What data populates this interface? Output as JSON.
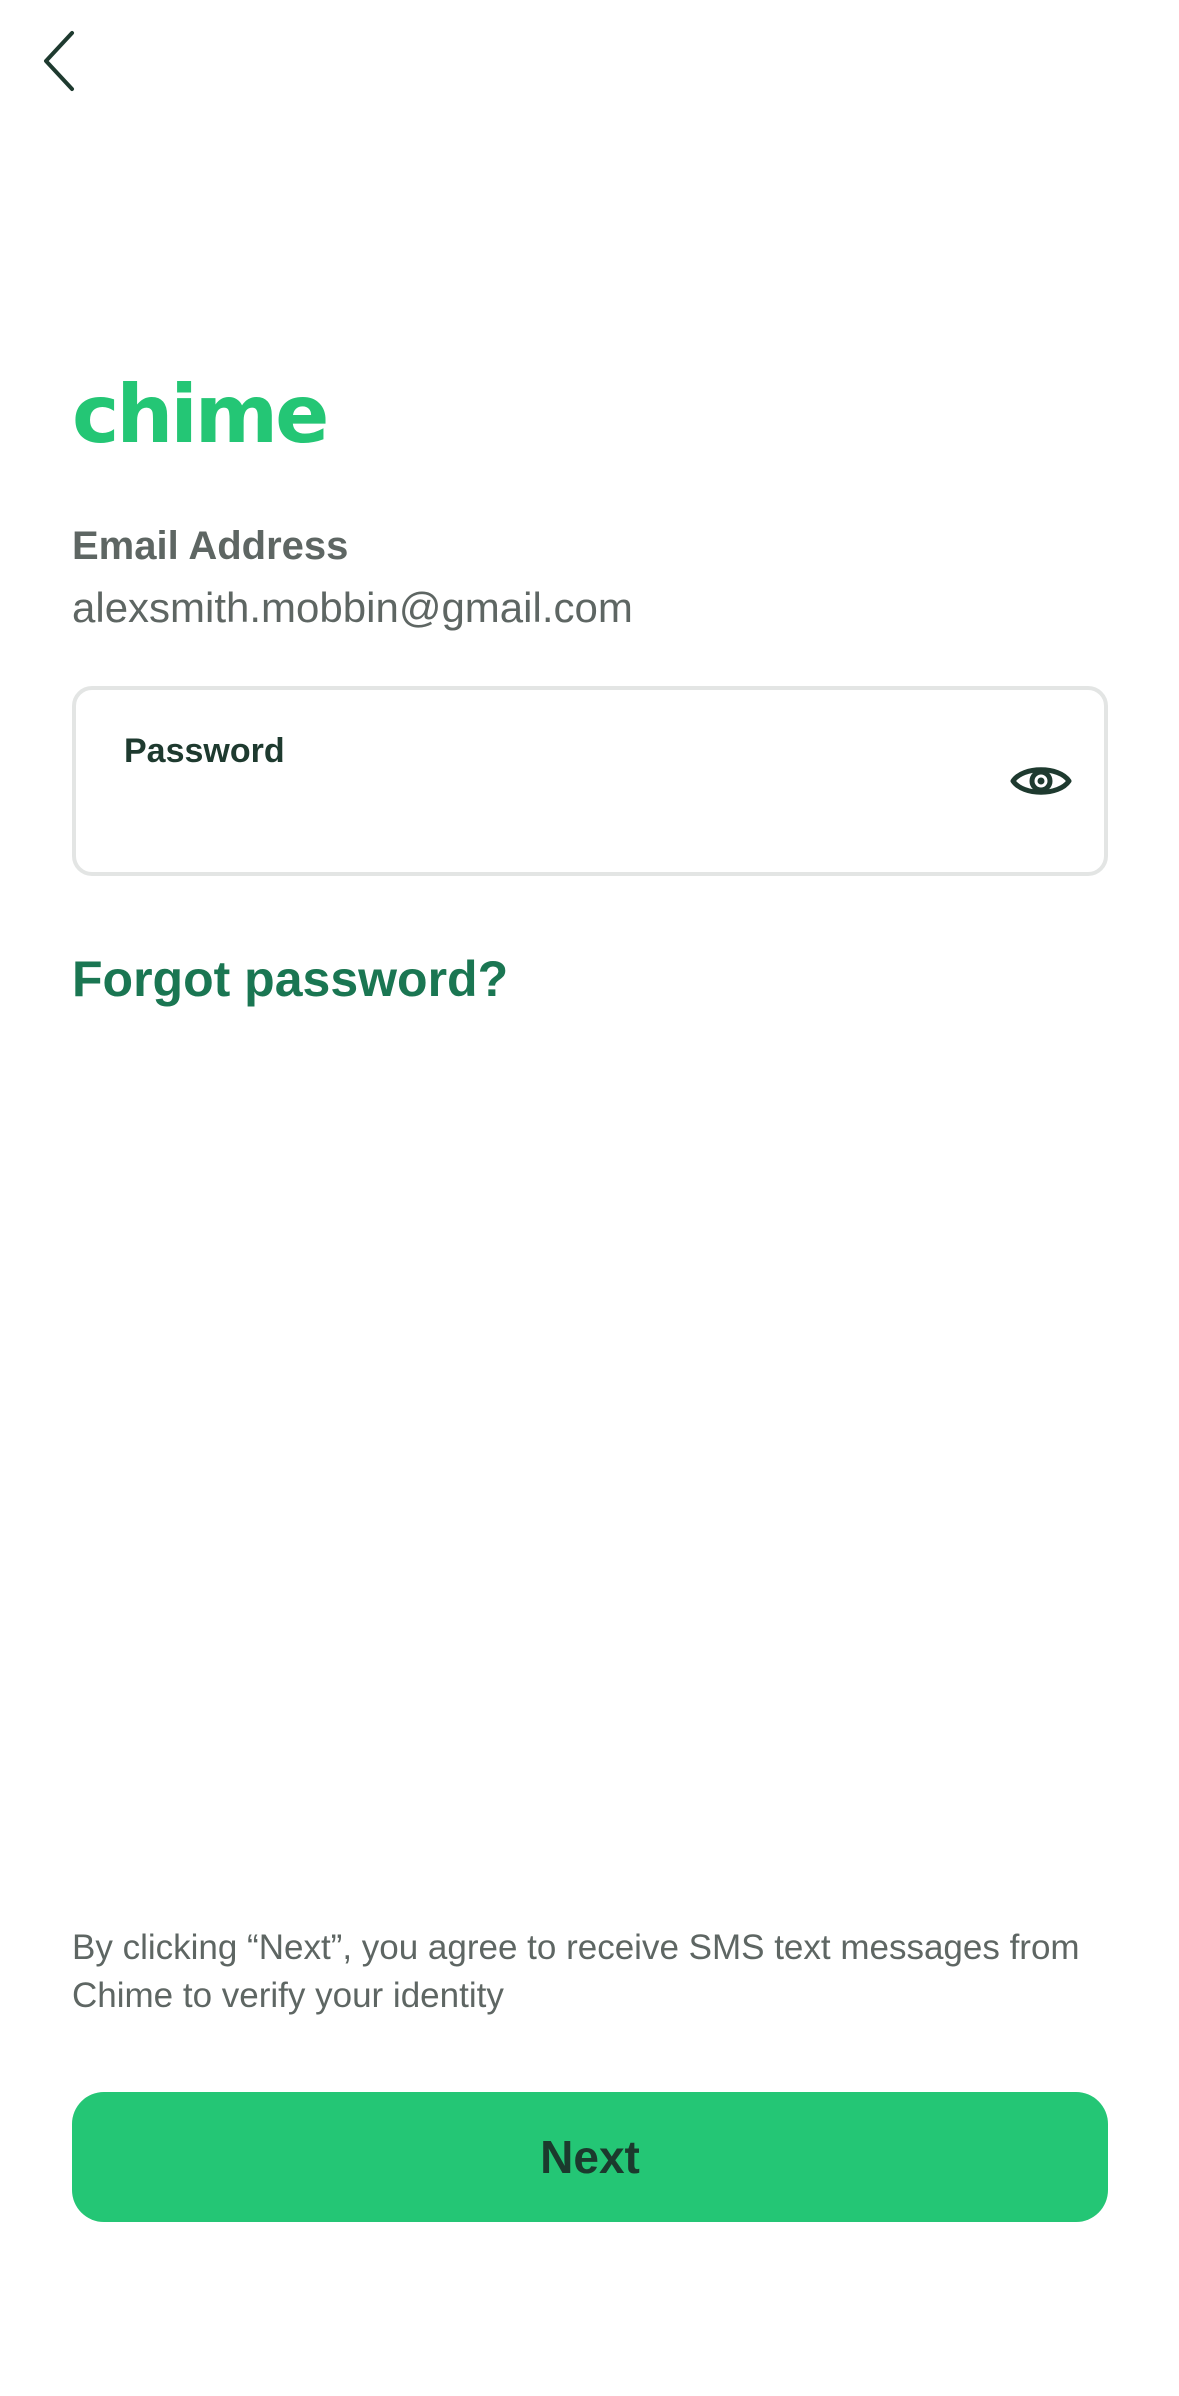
{
  "header": {
    "back_icon": "chevron-left-icon"
  },
  "brand": {
    "logo_text": "chime",
    "color": "#24c675"
  },
  "account": {
    "email_label": "Email Address",
    "email_value": "alexsmith.mobbin@gmail.com"
  },
  "password_field": {
    "label": "Password",
    "value": "",
    "toggle_icon": "eye-icon"
  },
  "links": {
    "forgot_password": "Forgot password?"
  },
  "footer": {
    "disclaimer": "By clicking “Next”, you agree to receive SMS text messages from Chime to verify your identity",
    "next_label": "Next"
  },
  "colors": {
    "accent": "#24c675",
    "link": "#1a7652",
    "text_muted": "#5e6663",
    "text_dark": "#1e3a2f",
    "border": "#e3e5e4"
  }
}
